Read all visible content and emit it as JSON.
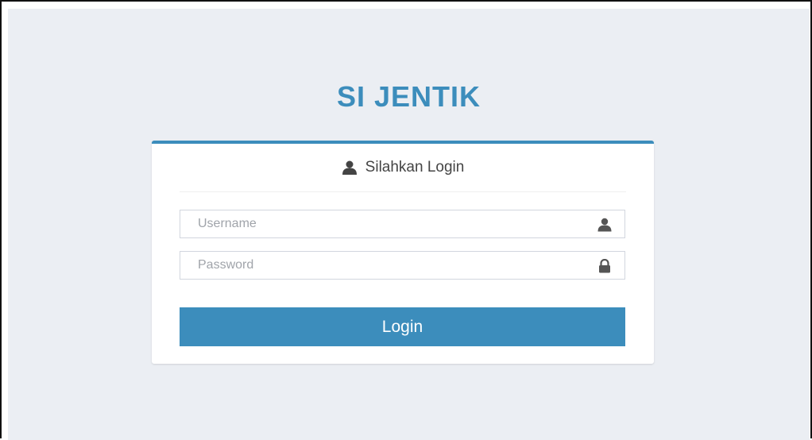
{
  "app": {
    "title": "SI JENTIK"
  },
  "login_box": {
    "header_label": "Silahkan Login",
    "header_icon": "user-icon",
    "username": {
      "value": "",
      "placeholder": "Username",
      "icon": "user-icon"
    },
    "password": {
      "value": "",
      "placeholder": "Password",
      "icon": "lock-icon"
    },
    "submit_label": "Login"
  },
  "colors": {
    "accent": "#3c8dbc",
    "background": "#ebeef3",
    "box_background": "#ffffff",
    "input_border": "#d2d6de",
    "text": "#444444"
  }
}
